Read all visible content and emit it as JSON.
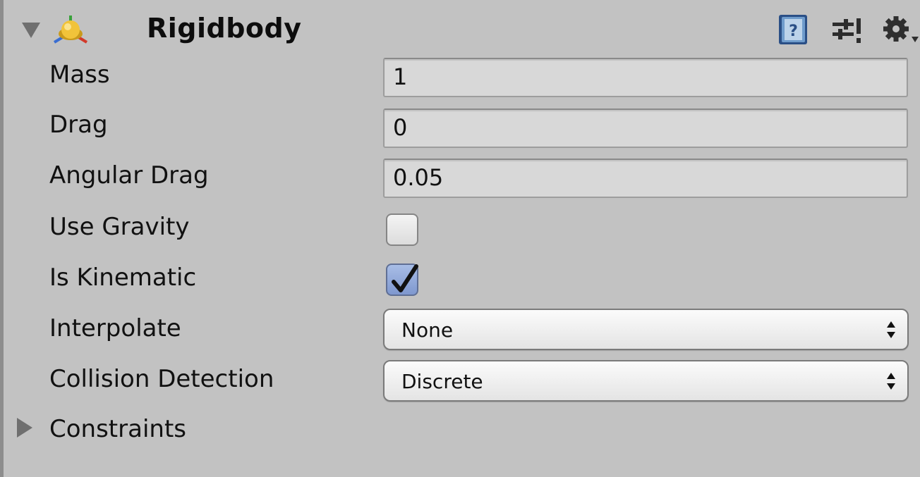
{
  "component": {
    "title": "Rigidbody"
  },
  "properties": {
    "mass": {
      "label": "Mass",
      "value": "1"
    },
    "drag": {
      "label": "Drag",
      "value": "0"
    },
    "angular_drag": {
      "label": "Angular Drag",
      "value": "0.05"
    },
    "use_gravity": {
      "label": "Use Gravity",
      "checked": false
    },
    "is_kinematic": {
      "label": "Is Kinematic",
      "checked": true
    },
    "interpolate": {
      "label": "Interpolate",
      "value": "None"
    },
    "collision_detection": {
      "label": "Collision Detection",
      "value": "Discrete"
    },
    "constraints": {
      "label": "Constraints",
      "expanded": false
    }
  },
  "icons": {
    "foldout": "triangle-down-icon",
    "component": "rigidbody-icon",
    "help": "help-book-icon",
    "presets": "preset-sliders-icon",
    "settings": "gear-icon",
    "constraints_foldout": "triangle-right-icon"
  },
  "colors": {
    "background": "#c2c2c2",
    "field": "#d8d8d8",
    "checkbox_checked": "#8ea5d8"
  }
}
